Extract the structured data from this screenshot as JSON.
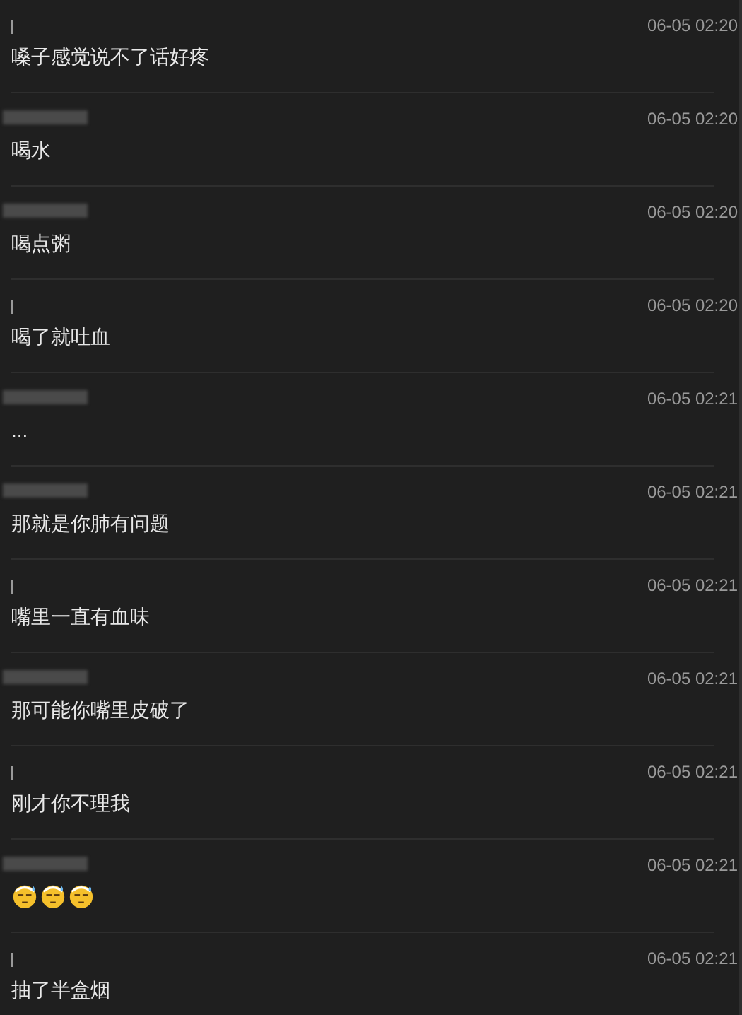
{
  "messages": [
    {
      "sender": {
        "kind": "bar"
      },
      "time": "06-05 02:20",
      "text": "嗓子感觉说不了话好疼"
    },
    {
      "sender": {
        "kind": "blurred"
      },
      "time": "06-05 02:20",
      "text": "喝水"
    },
    {
      "sender": {
        "kind": "blurred"
      },
      "time": "06-05 02:20",
      "text": "喝点粥"
    },
    {
      "sender": {
        "kind": "bar"
      },
      "time": "06-05 02:20",
      "text": "喝了就吐血"
    },
    {
      "sender": {
        "kind": "blurred"
      },
      "time": "06-05 02:21",
      "text": "..."
    },
    {
      "sender": {
        "kind": "blurred"
      },
      "time": "06-05 02:21",
      "text": "那就是你肺有问题"
    },
    {
      "sender": {
        "kind": "bar"
      },
      "time": "06-05 02:21",
      "text": "嘴里一直有血味"
    },
    {
      "sender": {
        "kind": "blurred"
      },
      "time": "06-05 02:21",
      "text": "那可能你嘴里皮破了"
    },
    {
      "sender": {
        "kind": "bar"
      },
      "time": "06-05 02:21",
      "text": "刚才你不理我"
    },
    {
      "sender": {
        "kind": "blurred"
      },
      "time": "06-05 02:21",
      "emojis": [
        {
          "kind": "sweat-face"
        },
        {
          "kind": "sweat-face"
        },
        {
          "kind": "sweat-face"
        }
      ]
    },
    {
      "sender": {
        "kind": "bar"
      },
      "time": "06-05 02:21",
      "text": "抽了半盒烟"
    }
  ]
}
